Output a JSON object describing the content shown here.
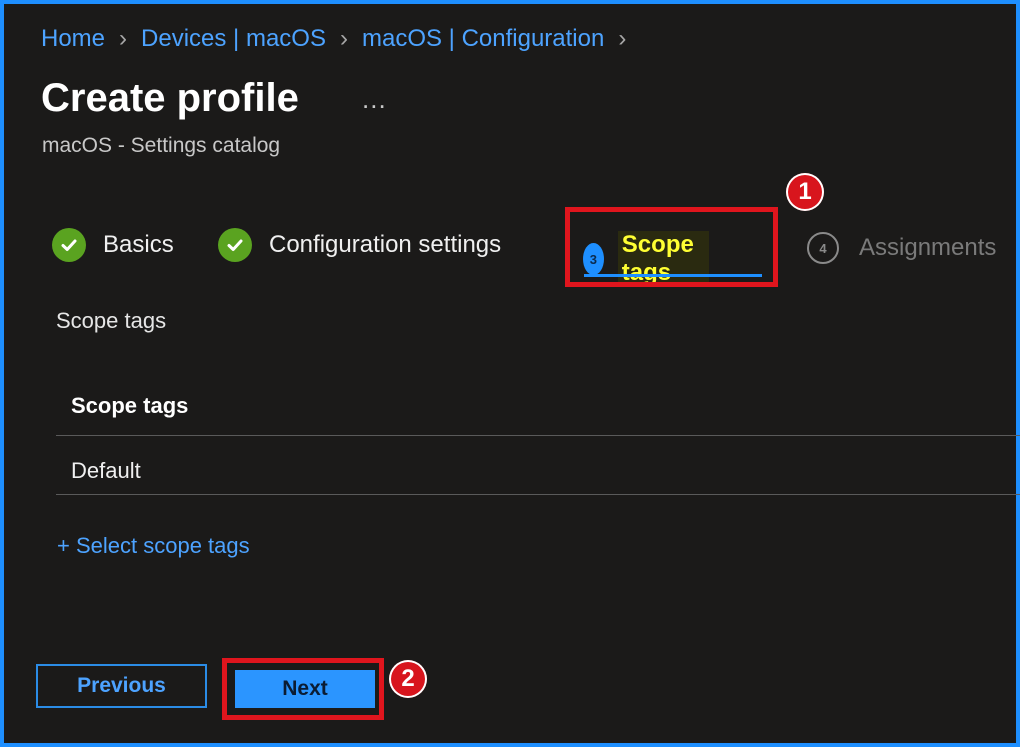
{
  "breadcrumb": [
    "Home",
    "Devices | macOS",
    "macOS | Configuration"
  ],
  "page": {
    "title": "Create profile",
    "more": "...",
    "subtitle": "macOS - Settings catalog"
  },
  "steps": [
    {
      "label": "Basics",
      "state": "completed"
    },
    {
      "label": "Configuration settings",
      "state": "completed"
    },
    {
      "number": "3",
      "label": "Scope tags",
      "state": "active"
    },
    {
      "number": "4",
      "label": "Assignments",
      "state": "upcoming"
    }
  ],
  "annotations": {
    "marker1": "1",
    "marker2": "2",
    "box_color": "#e0151d"
  },
  "scope": {
    "section_label": "Scope tags",
    "table_header": "Scope tags",
    "rows": [
      "Default"
    ],
    "add_link": "+ Select scope tags"
  },
  "buttons": {
    "previous": "Previous",
    "next": "Next"
  },
  "colors": {
    "accent": "#1e8fff",
    "success": "#5aa320",
    "highlight_text": "#ffff33",
    "background": "#1b1a19"
  }
}
